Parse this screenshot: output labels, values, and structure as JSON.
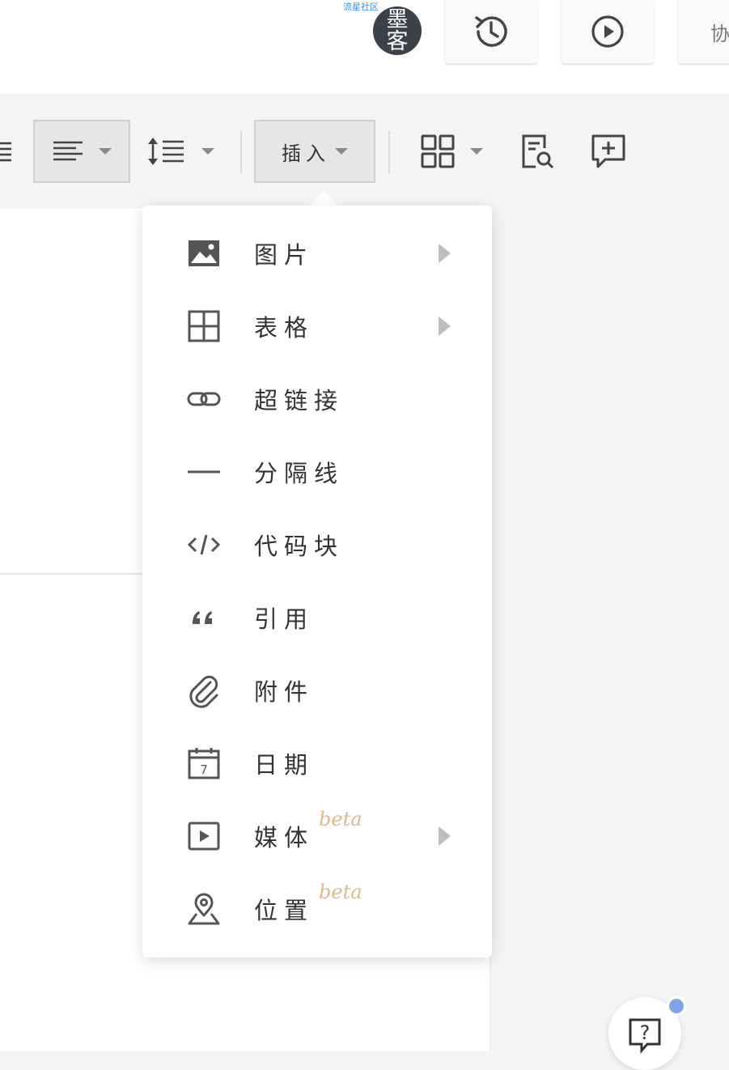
{
  "header": {
    "brand_tag": "流星社区",
    "avatar_text_top": "墨",
    "avatar_text_bottom": "客",
    "buttons": [
      {
        "icon": "history-icon"
      },
      {
        "icon": "play-circle-icon"
      },
      {
        "label": "协",
        "partial": true
      }
    ]
  },
  "toolbar": {
    "insert_label": "插入",
    "items": [
      {
        "icon": "list-icon"
      },
      {
        "icon": "align-left-icon",
        "active": true
      },
      {
        "icon": "line-height-icon"
      },
      {
        "icon": "insert-dropdown",
        "active": true
      },
      {
        "icon": "grid-layout-icon"
      },
      {
        "icon": "find-document-icon"
      },
      {
        "icon": "add-comment-icon"
      }
    ]
  },
  "insert_menu": {
    "items": [
      {
        "label": "图片",
        "icon": "image-icon",
        "submenu": true
      },
      {
        "label": "表格",
        "icon": "table-icon",
        "submenu": true
      },
      {
        "label": "超链接",
        "icon": "link-icon",
        "submenu": false
      },
      {
        "label": "分隔线",
        "icon": "divider-icon",
        "submenu": false
      },
      {
        "label": "代码块",
        "icon": "code-icon",
        "submenu": false
      },
      {
        "label": "引用",
        "icon": "quote-icon",
        "submenu": false
      },
      {
        "label": "附件",
        "icon": "attachment-icon",
        "submenu": false
      },
      {
        "label": "日期",
        "icon": "calendar-icon",
        "submenu": false,
        "calendar_day": "7"
      },
      {
        "label": "媒体",
        "icon": "media-icon",
        "submenu": true,
        "badge": "beta"
      },
      {
        "label": "位置",
        "icon": "location-icon",
        "submenu": false,
        "badge": "beta"
      }
    ]
  },
  "help": {
    "icon": "help-icon",
    "label": "?"
  },
  "colors": {
    "icon": "#555555",
    "badge": "#e0b98a",
    "notification_dot": "#7ea7e6",
    "brand_tag": "#3a8ee6"
  }
}
